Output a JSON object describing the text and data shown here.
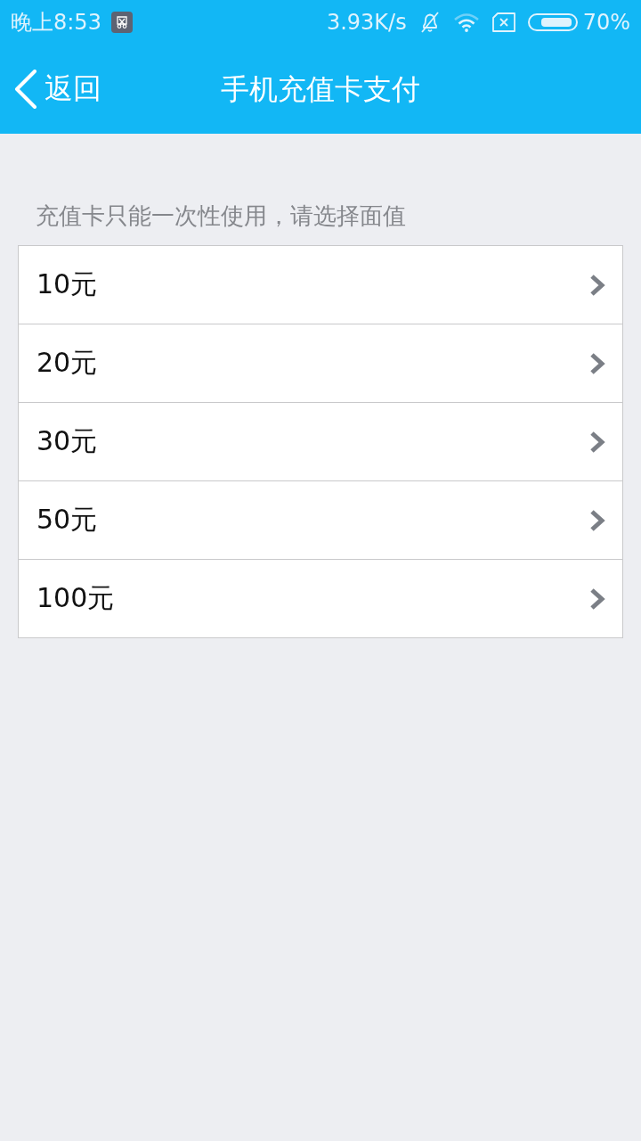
{
  "status_bar": {
    "time": "晚上8:53",
    "net_speed": "3.93K/s",
    "battery": "70%"
  },
  "header": {
    "back": "返回",
    "title": "手机充值卡支付"
  },
  "hint": "充值卡只能一次性使用，请选择面值",
  "options": [
    {
      "label": "10元"
    },
    {
      "label": "20元"
    },
    {
      "label": "30元"
    },
    {
      "label": "50元"
    },
    {
      "label": "100元"
    }
  ]
}
